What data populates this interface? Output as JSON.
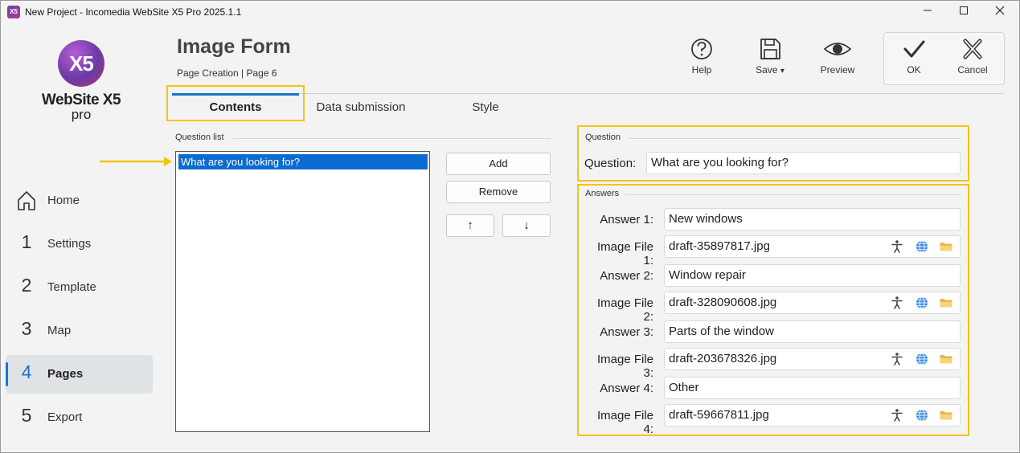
{
  "window": {
    "title": "New Project - Incomedia WebSite X5 Pro 2025.1.1",
    "app_icon_text": "X5"
  },
  "logo": {
    "mark": "X5",
    "name": "WebSite X5",
    "edition": "pro"
  },
  "sidebar": {
    "items": [
      {
        "num": "",
        "label": "Home",
        "icon": "home-icon"
      },
      {
        "num": "1",
        "label": "Settings"
      },
      {
        "num": "2",
        "label": "Template"
      },
      {
        "num": "3",
        "label": "Map"
      },
      {
        "num": "4",
        "label": "Pages",
        "active": true
      },
      {
        "num": "5",
        "label": "Export"
      }
    ]
  },
  "header": {
    "title": "Image Form",
    "breadcrumb": "Page Creation | Page 6"
  },
  "toolbar": {
    "help": "Help",
    "save": "Save",
    "save_arrow": "▾",
    "preview": "Preview",
    "ok": "OK",
    "cancel": "Cancel"
  },
  "tabs": [
    {
      "label": "Contents",
      "active": true
    },
    {
      "label": "Data submission"
    },
    {
      "label": "Style"
    }
  ],
  "question_list": {
    "title": "Question list",
    "items": [
      "What are you looking for?"
    ],
    "add": "Add",
    "remove": "Remove",
    "up": "↑",
    "down": "↓"
  },
  "question": {
    "group_title": "Question",
    "label": "Question:",
    "value": "What are you looking for?"
  },
  "answers": {
    "group_title": "Answers",
    "rows": [
      {
        "answer_label": "Answer 1:",
        "answer": "New windows",
        "file_label": "Image File 1:",
        "file": "draft-35897817.jpg"
      },
      {
        "answer_label": "Answer 2:",
        "answer": "Window repair",
        "file_label": "Image File 2:",
        "file": "draft-328090608.jpg"
      },
      {
        "answer_label": "Answer 3:",
        "answer": "Parts of the window",
        "file_label": "Image File 3:",
        "file": "draft-203678326.jpg"
      },
      {
        "answer_label": "Answer 4:",
        "answer": "Other",
        "file_label": "Image File 4:",
        "file": "draft-59667811.jpg"
      }
    ]
  },
  "colors": {
    "accent": "#1a73c9",
    "highlight": "#f2c518",
    "selection": "#0a6bd1"
  }
}
